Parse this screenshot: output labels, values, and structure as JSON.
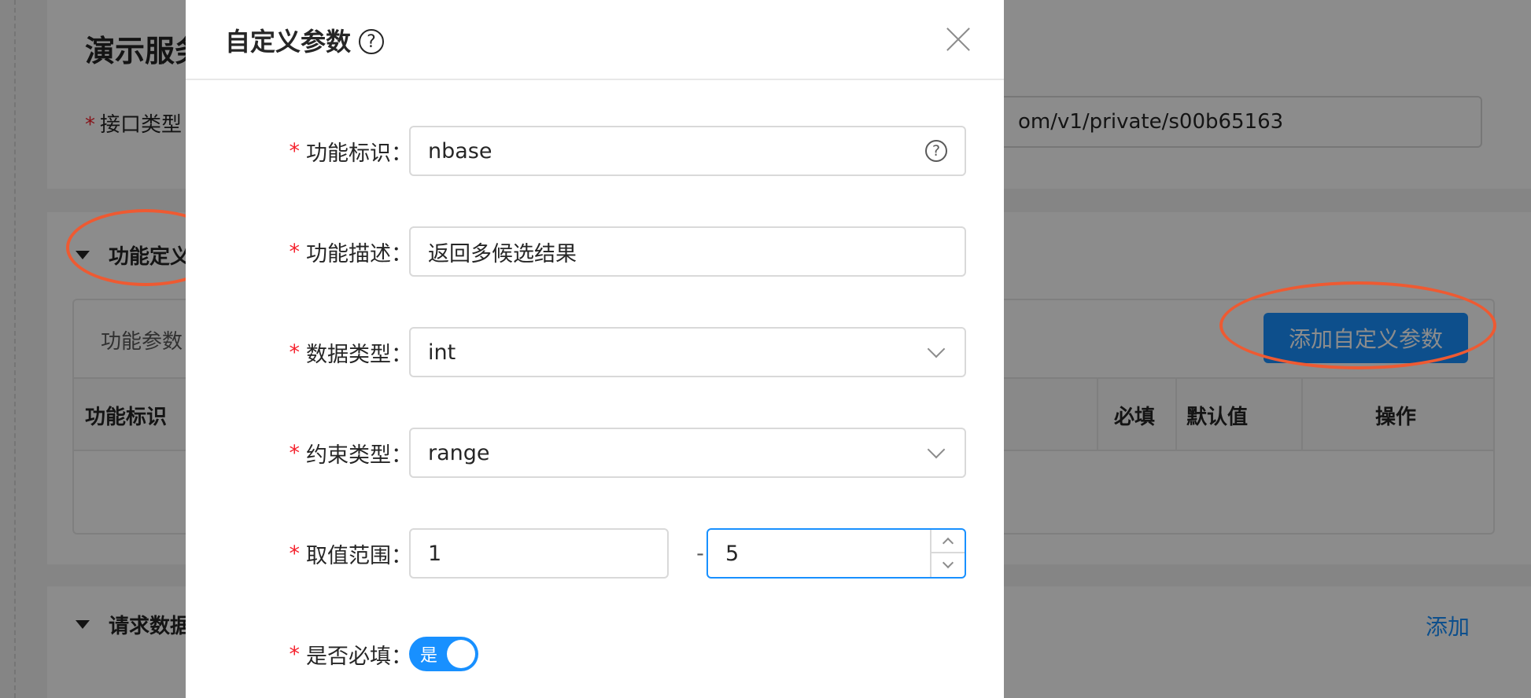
{
  "background": {
    "page_title": "演示服务",
    "interface_type_label": "接口类型",
    "url_value": "om/v1/private/s00b65163",
    "section_function": "功能定义",
    "tab_label": "功能参数",
    "add_custom_param_button": "添加自定义参数",
    "table_headers": {
      "identifier": "功能标识",
      "required": "必填",
      "default_value": "默认值",
      "actions": "操作"
    },
    "section_request": "请求数据",
    "add_link": "添加"
  },
  "modal": {
    "title": "自定义参数",
    "fields": {
      "identifier": {
        "label": "功能标识",
        "value": "nbase"
      },
      "description": {
        "label": "功能描述",
        "value": "返回多候选结果"
      },
      "data_type": {
        "label": "数据类型",
        "value": "int"
      },
      "constraint_type": {
        "label": "约束类型",
        "value": "range"
      },
      "value_range": {
        "label": "取值范围",
        "min": "1",
        "separator": "-",
        "max": "5"
      },
      "required": {
        "label": "是否必填",
        "switch_text": "是",
        "checked": true
      }
    }
  },
  "colors": {
    "primary": "#1890ff",
    "annotation": "#ee5a32",
    "required_star": "#f5222d"
  }
}
